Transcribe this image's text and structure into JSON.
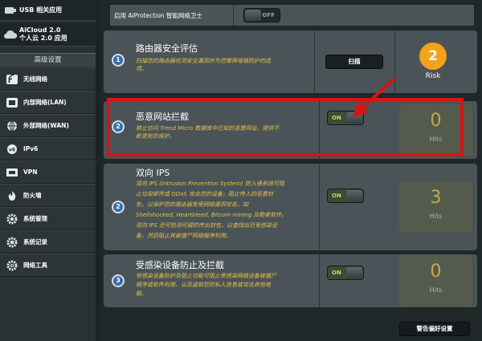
{
  "sidebar": {
    "usb_label": "USB 相关应用",
    "aicloud_line1": "AiCloud 2.0",
    "aicloud_line2": "个人云 2.0 应用",
    "advanced_header": "高级设置",
    "items": [
      {
        "label": "无线网络",
        "icon": "wifi-icon"
      },
      {
        "label": "内部网络(LAN)",
        "icon": "lan-icon"
      },
      {
        "label": "外部网络(WAN)",
        "icon": "globe-icon"
      },
      {
        "label": "IPv6",
        "icon": "ipv6-icon"
      },
      {
        "label": "VPN",
        "icon": "vpn-icon"
      },
      {
        "label": "防火墙",
        "icon": "fire-icon"
      },
      {
        "label": "系统管理",
        "icon": "gear-icon"
      },
      {
        "label": "系统记录",
        "icon": "log-icon"
      },
      {
        "label": "网络工具",
        "icon": "tools-icon"
      }
    ]
  },
  "aiprotection": {
    "label": "启用 AiProtection 智能网络卫士",
    "toggle": "OFF"
  },
  "sections": [
    {
      "number": "1",
      "title": "路由器安全评估",
      "desc": [
        "扫描您的路由器检测安全漏洞并为您推荐增强防护的选",
        "项。"
      ],
      "button": "扫描",
      "risk_value": "2",
      "risk_label": "Risk"
    },
    {
      "number": "2",
      "title": "恶意网站拦截",
      "desc": [
        "禁止访问 Trend Micro 数据库中已知的恶意网站，提供不",
        "断更新的保护。"
      ],
      "toggle": "ON",
      "hits_value": "0",
      "hits_label": "Hits"
    },
    {
      "number": "2",
      "title": "双向 IPS",
      "desc": [
        "双向 IPS (Intrusion Prevention System) 防入侵系统可阻",
        "止垃圾邮件或 DDoS 攻击您的设备，阻止传入的恶意封",
        "包，以保护您的路由器免受网络漏洞攻击，如",
        "Shellshocked, Heartbleed, Bitcoin mining 及勒索软件。",
        "双向 IPS 还可检测可疑的传出封包，以查找出已受感染设",
        "备，然后阻止其被僵尸网络程序利用。"
      ],
      "toggle": "ON",
      "hits_value": "3",
      "hits_label": "Hits"
    },
    {
      "number": "3",
      "title": "受感染设备防止及拦截",
      "desc": [
        "受感染设备防护及阻止功能可阻止受感染网络设备被僵尸",
        "程序或软件利用，以及盗取您的私人信息或攻击其他电",
        "脑。"
      ],
      "toggle": "ON",
      "hits_value": "0",
      "hits_label": "Hits"
    }
  ],
  "report_button": "警告偏好设置",
  "colors": {
    "accent_orange": "#f3a21a",
    "highlight_red": "#d61414",
    "on_green": "#a9e26d",
    "desc_yellow": "#e7c24a"
  }
}
